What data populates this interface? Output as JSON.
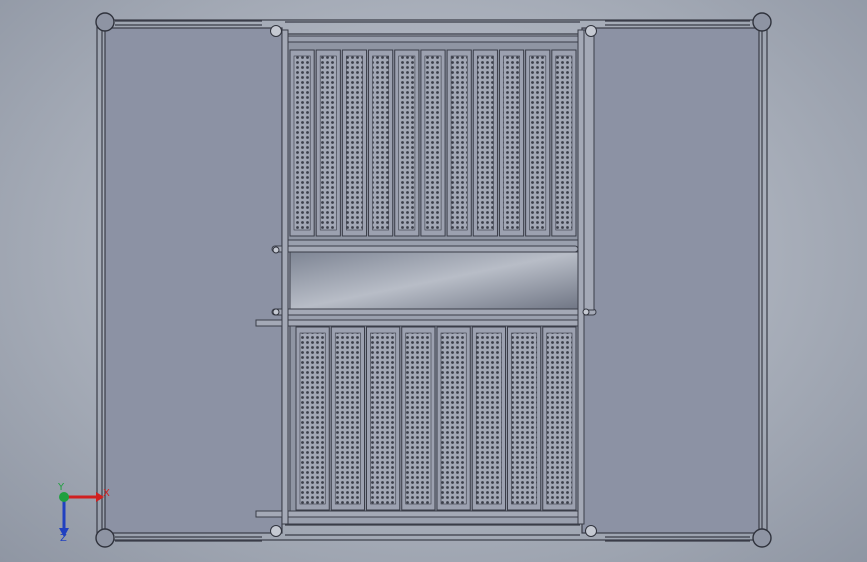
{
  "triad": {
    "x_label": "X",
    "y_label": "Y",
    "z_label": "Z"
  },
  "colors": {
    "panel": "#8c92a4",
    "panel_edge": "#3a3d48",
    "perforated": "#9ca1b0",
    "x_axis": "#d02020",
    "y_axis": "#20a040",
    "z_axis": "#2040c0"
  },
  "model": {
    "top_bay_grille_panels": 11,
    "bottom_bay_grille_panels": 8
  }
}
